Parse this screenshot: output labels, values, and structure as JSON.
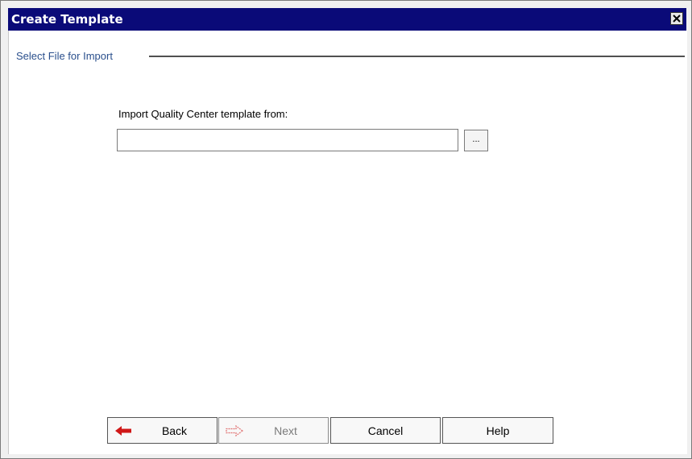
{
  "window": {
    "title": "Create Template"
  },
  "section": {
    "title": "Select File for Import"
  },
  "form": {
    "import_label": "Import Quality Center template from:",
    "path_value": "",
    "browse_label": "..."
  },
  "buttons": {
    "back": "Back",
    "next": "Next",
    "cancel": "Cancel",
    "help": "Help"
  },
  "icons": {
    "close": "close-icon",
    "back": "arrow-left-icon",
    "next": "arrow-right-icon"
  },
  "colors": {
    "titlebar": "#0a0a78",
    "section_title": "#2a4f8c",
    "back_arrow": "#d01818",
    "next_arrow_disabled": "#e07070"
  }
}
